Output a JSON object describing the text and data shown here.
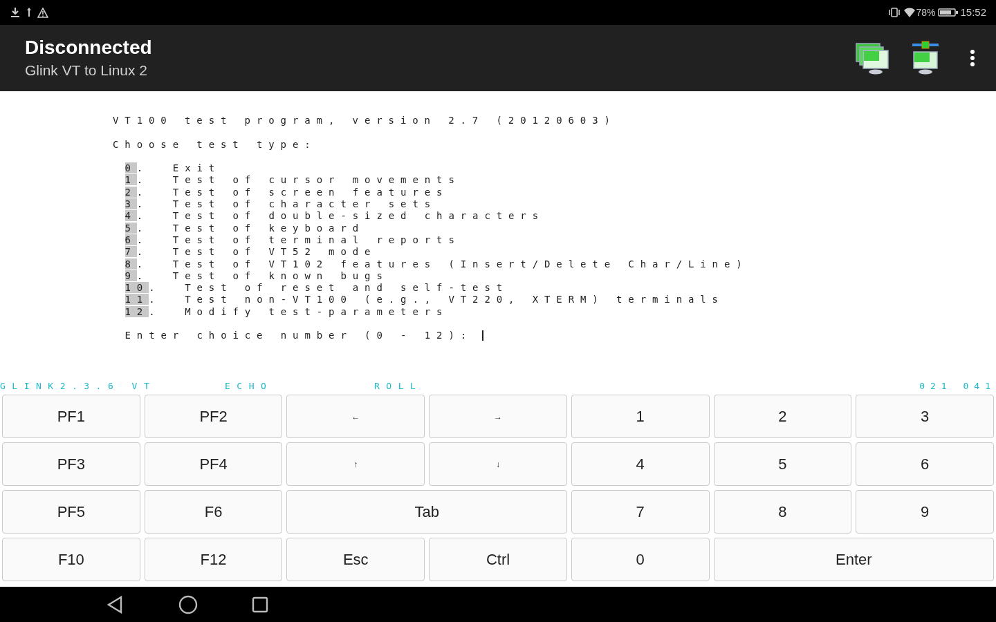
{
  "status_bar": {
    "battery_text": "78%",
    "time": "15:52"
  },
  "app_bar": {
    "title": "Disconnected",
    "subtitle": "Glink VT to Linux 2"
  },
  "terminal": {
    "heading": "VT100 test program, version 2.7 (20120603)",
    "subheading": "Choose test type:",
    "menu": [
      {
        "key": "0",
        "text": ".  Exit"
      },
      {
        "key": "1",
        "text": ".  Test of cursor movements"
      },
      {
        "key": "2",
        "text": ".  Test of screen features"
      },
      {
        "key": "3",
        "text": ".  Test of character sets"
      },
      {
        "key": "4",
        "text": ".  Test of double-sized characters"
      },
      {
        "key": "5",
        "text": ".  Test of keyboard"
      },
      {
        "key": "6",
        "text": ".  Test of terminal reports"
      },
      {
        "key": "7",
        "text": ".  Test of VT52 mode"
      },
      {
        "key": "8",
        "text": ".  Test of VT102 features (Insert/Delete Char/Line)"
      },
      {
        "key": "9",
        "text": ".  Test of known bugs"
      },
      {
        "key": "10",
        "text": ".  Test of reset and self-test"
      },
      {
        "key": "11",
        "text": ".  Test non-VT100 (e.g., VT220, XTERM) terminals"
      },
      {
        "key": "12",
        "text": ".  Modify test-parameters"
      }
    ],
    "prompt": "Enter choice number (0 - 12):"
  },
  "emulator_status": {
    "version": "GLINK2.3.6 VT",
    "echo": "ECHO",
    "roll": "ROLL",
    "position": "021 041"
  },
  "keypad": [
    {
      "label": "PF1",
      "kind": "normal"
    },
    {
      "label": "PF2",
      "kind": "normal"
    },
    {
      "label": "←",
      "kind": "arrow"
    },
    {
      "label": "→",
      "kind": "arrow"
    },
    {
      "label": "1",
      "kind": "normal"
    },
    {
      "label": "2",
      "kind": "normal"
    },
    {
      "label": "3",
      "kind": "normal"
    },
    {
      "label": "PF3",
      "kind": "normal"
    },
    {
      "label": "PF4",
      "kind": "normal"
    },
    {
      "label": "↑",
      "kind": "arrow"
    },
    {
      "label": "↓",
      "kind": "arrow"
    },
    {
      "label": "4",
      "kind": "normal"
    },
    {
      "label": "5",
      "kind": "normal"
    },
    {
      "label": "6",
      "kind": "normal"
    },
    {
      "label": "PF5",
      "kind": "normal"
    },
    {
      "label": "F6",
      "kind": "normal"
    },
    {
      "label": "Tab",
      "kind": "wide"
    },
    {
      "label": "7",
      "kind": "normal"
    },
    {
      "label": "8",
      "kind": "normal"
    },
    {
      "label": "9",
      "kind": "normal"
    },
    {
      "label": "F10",
      "kind": "normal"
    },
    {
      "label": "F12",
      "kind": "normal"
    },
    {
      "label": "Esc",
      "kind": "normal"
    },
    {
      "label": "Ctrl",
      "kind": "normal"
    },
    {
      "label": "0",
      "kind": "normal"
    },
    {
      "label": "Enter",
      "kind": "wide"
    }
  ]
}
